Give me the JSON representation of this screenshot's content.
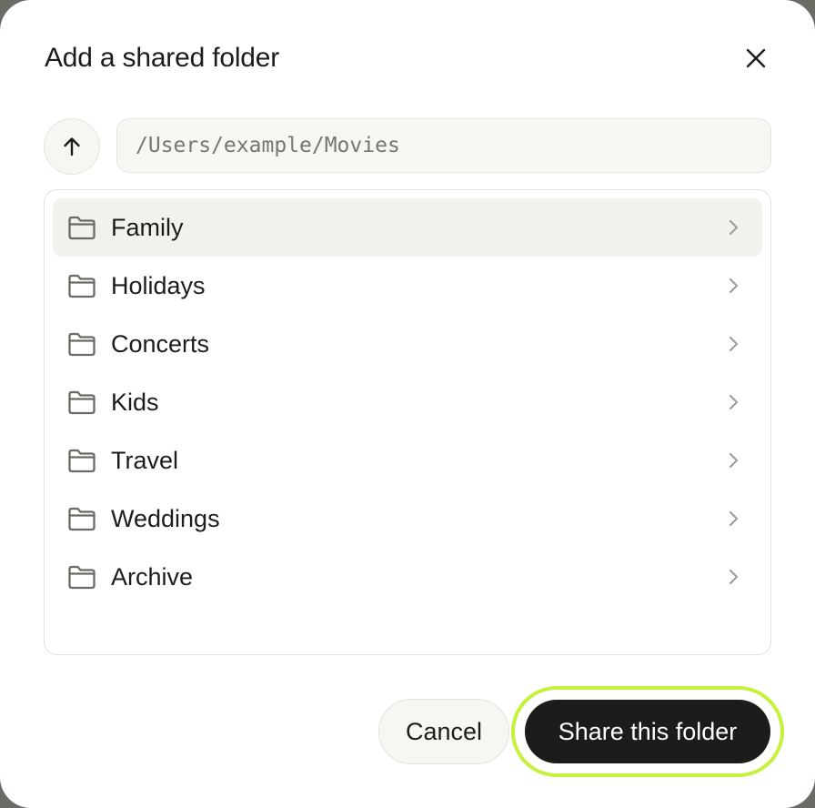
{
  "dialog": {
    "title": "Add a shared folder",
    "close_icon": "close-icon"
  },
  "navigation": {
    "up_icon": "arrow-up-icon",
    "path_value": "/Users/example/Movies"
  },
  "folders": [
    {
      "label": "Family",
      "selected": true
    },
    {
      "label": "Holidays",
      "selected": false
    },
    {
      "label": "Concerts",
      "selected": false
    },
    {
      "label": "Kids",
      "selected": false
    },
    {
      "label": "Travel",
      "selected": false
    },
    {
      "label": "Weddings",
      "selected": false
    },
    {
      "label": "Archive",
      "selected": false
    }
  ],
  "icons": {
    "folder": "folder-icon",
    "chevron": "chevron-right-icon"
  },
  "actions": {
    "cancel_label": "Cancel",
    "share_label": "Share this folder"
  },
  "colors": {
    "primary_button": "#1c1c1a",
    "focus_ring": "#c5f23c",
    "selected_row": "#f1f1ed"
  }
}
